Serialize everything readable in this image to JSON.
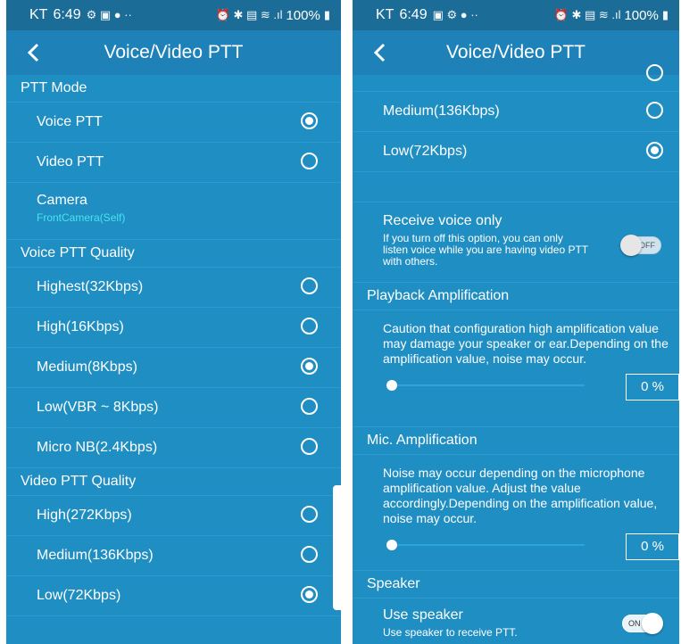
{
  "status": {
    "carrier": "KT",
    "time": "6:49",
    "battery": "100%"
  },
  "appbar": {
    "title": "Voice/Video PTT"
  },
  "left": {
    "ptt_mode": {
      "header": "PTT Mode",
      "options": [
        {
          "label": "Voice PTT",
          "selected": true
        },
        {
          "label": "Video PTT",
          "selected": false
        }
      ]
    },
    "camera": {
      "label": "Camera",
      "value": "FrontCamera(Self)"
    },
    "voice_quality": {
      "header": "Voice PTT Quality",
      "options": [
        {
          "label": "Highest(32Kbps)",
          "selected": false
        },
        {
          "label": "High(16Kbps)",
          "selected": false
        },
        {
          "label": "Medium(8Kbps)",
          "selected": true
        },
        {
          "label": "Low(VBR ~ 8Kbps)",
          "selected": false
        },
        {
          "label": "Micro NB(2.4Kbps)",
          "selected": false
        }
      ]
    },
    "video_quality": {
      "header": "Video PTT Quality",
      "options": [
        {
          "label": "High(272Kbps)",
          "selected": false
        },
        {
          "label": "Medium(136Kbps)",
          "selected": false
        },
        {
          "label": "Low(72Kbps)",
          "selected": true
        }
      ]
    }
  },
  "right": {
    "video_quality_tail": [
      {
        "label": "Medium(136Kbps)",
        "selected": false
      },
      {
        "label": "Low(72Kbps)",
        "selected": true
      }
    ],
    "receive_voice": {
      "title": "Receive voice only",
      "desc": "If you turn off this option, you can only listen voice while you are having video PTT with others.",
      "toggle": "OFF",
      "on": false
    },
    "playback": {
      "header": "Playback Amplification",
      "caution": "Caution that configuration high amplification value may damage your speaker or ear.Depending on the amplification value, noise may occur.",
      "value": "0 %",
      "level": 0
    },
    "mic": {
      "header": "Mic. Amplification",
      "caution": "Noise may occur depending on the microphone amplification value. Adjust the value accordingly.Depending on the amplification value, noise may occur.",
      "value": "0 %",
      "level": 0
    },
    "speaker": {
      "header": "Speaker",
      "title": "Use speaker",
      "desc": "Use speaker to receive PTT.",
      "toggle": "ON",
      "on": true
    }
  }
}
